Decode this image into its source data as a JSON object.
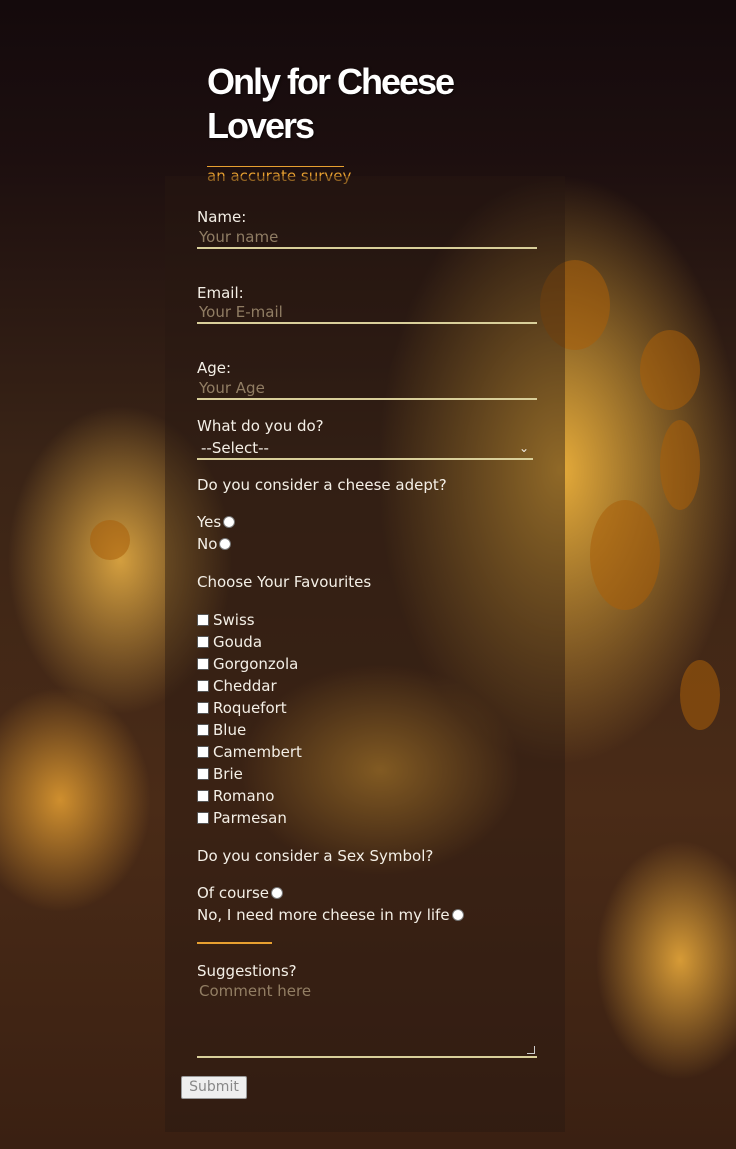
{
  "header": {
    "title": "Only for Cheese Lovers",
    "subtitle": "an accurate survey"
  },
  "form": {
    "name": {
      "label": "Name:",
      "placeholder": "Your name"
    },
    "email": {
      "label": "Email:",
      "placeholder": "Your E-mail"
    },
    "age": {
      "label": "Age:",
      "placeholder": "Your Age"
    },
    "occupation": {
      "label": "What do you do?",
      "selected": "--Select--"
    },
    "adept": {
      "question": "Do you consider a cheese adept?",
      "options": [
        "Yes",
        "No"
      ]
    },
    "favourites": {
      "question": "Choose Your Favourites",
      "options": [
        "Swiss",
        "Gouda",
        "Gorgonzola",
        "Cheddar",
        "Roquefort",
        "Blue",
        "Camembert",
        "Brie",
        "Romano",
        "Parmesan"
      ]
    },
    "sex_symbol": {
      "question": "Do you consider a Sex Symbol?",
      "options": [
        "Of course",
        "No, I need more cheese in my life"
      ]
    },
    "suggestions": {
      "label": "Suggestions?",
      "placeholder": "Comment here"
    },
    "submit_label": "Submit"
  }
}
